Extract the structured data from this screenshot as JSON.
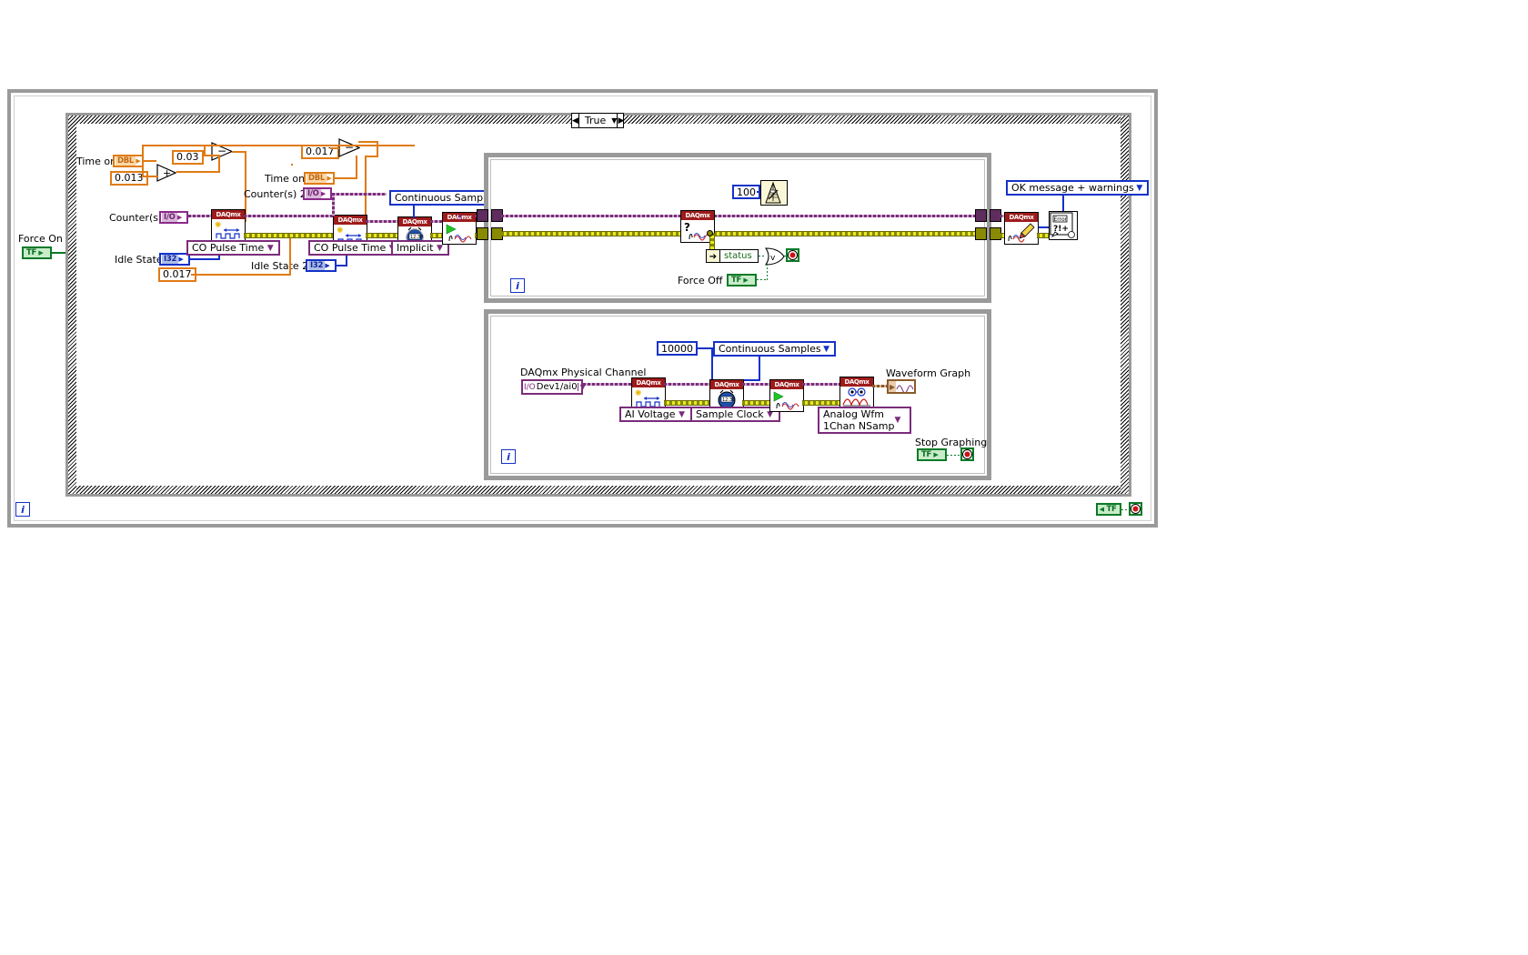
{
  "window": {
    "app": "LabVIEW Block Diagram",
    "case_selector": {
      "value": "True",
      "left_arrow": "◀",
      "right_arrow": "▶",
      "dropdown": "▼"
    }
  },
  "labels": {
    "force_on": "Force On",
    "time_on_1": "Time on",
    "time_on_2": "Time on",
    "counters": "Counter(s)",
    "counters_2": "Counter(s) 2",
    "idle_state": "Idle State",
    "idle_state_2": "Idle State 2",
    "force_off": "Force Off",
    "status": "status",
    "daqmx_physical_channel": "DAQmx Physical Channel",
    "waveform_graph": "Waveform Graph",
    "stop_graphing": "Stop Graphing"
  },
  "constants": {
    "c_0013": "0.013",
    "c_003": "0.03",
    "c_0017_top": "0.017",
    "c_0017_bottom": "0.017",
    "c_100": "100",
    "c_10000": "10000"
  },
  "terminals": {
    "force_on": "TF",
    "time_on_1": "DBL",
    "time_on_2": "DBL",
    "counters": "I/O",
    "counters_2": "I/O",
    "idle_state": "I32",
    "idle_state_2": "I32",
    "force_off": "TF",
    "physical_channel": "Dev1/ai0",
    "waveform_graph": "〜",
    "stop_graphing": "TF",
    "outer_stop": "TF"
  },
  "rings": {
    "continuous_samples_top": "Continuous Samples",
    "continuous_samples_bottom": "Continuous Samples",
    "ok_message": "OK message + warnings",
    "co_pulse_time_1": "CO Pulse Time",
    "co_pulse_time_2": "CO Pulse Time",
    "implicit": "Implicit",
    "ai_voltage": "AI Voltage",
    "sample_clock": "Sample Clock",
    "analog_wfm_line1": "Analog Wfm",
    "analog_wfm_line2": "1Chan NSamp",
    "dropdown_glyph": "▼"
  },
  "nodes": {
    "daqmx_header": "DAQmx",
    "create_channel_1": "DAQmx Create Virtual Channel",
    "create_channel_2": "DAQmx Create Virtual Channel",
    "timing_1": "DAQmx Timing",
    "start_task_1": "DAQmx Start Task",
    "is_task_done": "DAQmx Is Task Done",
    "clear_task": "DAQmx Clear Task",
    "create_channel_ai": "DAQmx Create Virtual Channel",
    "timing_ai": "DAQmx Timing",
    "start_task_ai": "DAQmx Start Task",
    "read_ai": "DAQmx Read",
    "wait_ms": "Wait (ms)",
    "error_handler": "Simple Error Handler",
    "error_icon_text_1": "Error",
    "error_icon_text_2": "?!+",
    "iteration": "i"
  },
  "colors": {
    "daqmx_header_bg": "#9E1B1B",
    "task_wire": "#7B2C7B",
    "error_wire": "#E8E82A",
    "dbl_orange": "#E07B14",
    "i32_blue": "#1432C8",
    "bool_green": "#0A7A28",
    "structure_gray": "#9A9A9A",
    "waveform_brown": "#8B5A2B"
  }
}
